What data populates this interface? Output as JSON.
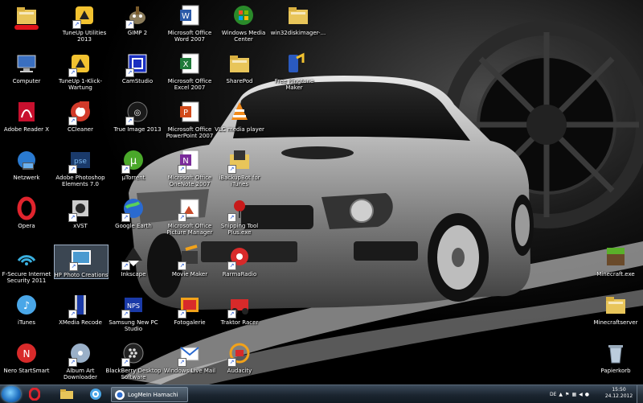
{
  "desktop": {
    "icons": [
      {
        "id": "folder-user",
        "label": "",
        "icon": "folder-icon"
      },
      {
        "id": "tuneup",
        "label": "TuneUp Utilities 2013",
        "icon": "tuneup-icon"
      },
      {
        "id": "gimp",
        "label": "GIMP 2",
        "icon": "gimp-icon"
      },
      {
        "id": "word",
        "label": "Microsoft Office Word 2007",
        "icon": "word-icon"
      },
      {
        "id": "wmc",
        "label": "Windows Media Center",
        "icon": "windows-media-center-icon"
      },
      {
        "id": "win32",
        "label": "win32diskimager-...",
        "icon": "folder-icon"
      },
      {
        "id": "computer",
        "label": "Computer",
        "icon": "computer-icon"
      },
      {
        "id": "tuneup1",
        "label": "TuneUp 1-Klick-Wartung",
        "icon": "tuneup-icon"
      },
      {
        "id": "camstudio",
        "label": "CamStudio",
        "icon": "camstudio-icon"
      },
      {
        "id": "excel",
        "label": "Microsoft Office Excel 2007",
        "icon": "excel-icon"
      },
      {
        "id": "sharepod",
        "label": "SharePod",
        "icon": "folder-icon"
      },
      {
        "id": "ringtone",
        "label": "Free Ringtone Maker",
        "icon": "ringtone-icon"
      },
      {
        "id": "reader",
        "label": "Adobe Reader X",
        "icon": "adobe-reader-icon"
      },
      {
        "id": "ccleaner",
        "label": "CCleaner",
        "icon": "ccleaner-icon"
      },
      {
        "id": "trueimage",
        "label": "True Image 2013",
        "icon": "true-image-icon"
      },
      {
        "id": "ppt",
        "label": "Microsoft Office PowerPoint 2007",
        "icon": "powerpoint-icon"
      },
      {
        "id": "vlc",
        "label": "VLC media player",
        "icon": "vlc-icon"
      },
      {
        "id": "netzwerk",
        "label": "Netzwerk",
        "icon": "network-icon"
      },
      {
        "id": "pse",
        "label": "Adobe Photoshop Elements 7.0",
        "icon": "photoshop-elements-icon"
      },
      {
        "id": "utorrent",
        "label": "µTorrent",
        "icon": "utorrent-icon"
      },
      {
        "id": "onenote",
        "label": "Microsoft Office OneNote 2007",
        "icon": "onenote-icon"
      },
      {
        "id": "ibackup",
        "label": "iBackupBot for iTunes",
        "icon": "ibackupbot-icon"
      },
      {
        "id": "opera",
        "label": "Opera",
        "icon": "opera-icon"
      },
      {
        "id": "xvst",
        "label": "xVST",
        "icon": "xvst-icon"
      },
      {
        "id": "gearth",
        "label": "Google Earth",
        "icon": "google-earth-icon"
      },
      {
        "id": "picmgr",
        "label": "Microsoft Office Picture Manager",
        "icon": "picture-manager-icon"
      },
      {
        "id": "snipping",
        "label": "Snipping Tool Plus.exe",
        "icon": "snipping-tool-icon"
      },
      {
        "id": "fsecure",
        "label": "F-Secure Internet Security 2011",
        "icon": "f-secure-icon"
      },
      {
        "id": "hpphoto",
        "label": "HP Photo Creations",
        "icon": "hp-photo-icon"
      },
      {
        "id": "inkscape",
        "label": "Inkscape",
        "icon": "inkscape-icon"
      },
      {
        "id": "moviemaker",
        "label": "Movie Maker",
        "icon": "movie-maker-icon"
      },
      {
        "id": "rarma",
        "label": "RarmaRadio",
        "icon": "rarmaradio-icon"
      },
      {
        "id": "minecraftexe",
        "label": "Minecraft.exe",
        "icon": "minecraft-icon"
      },
      {
        "id": "itunes",
        "label": "iTunes",
        "icon": "itunes-icon"
      },
      {
        "id": "xmedia",
        "label": "XMedia Recode",
        "icon": "xmedia-recode-icon"
      },
      {
        "id": "samsung",
        "label": "Samsung New PC Studio",
        "icon": "nps-icon"
      },
      {
        "id": "fotogalerie",
        "label": "Fotogalerie",
        "icon": "photo-gallery-icon"
      },
      {
        "id": "traktor",
        "label": "Traktor Racer",
        "icon": "traktor-racer-icon"
      },
      {
        "id": "minecraftserver",
        "label": "Minecraftserver",
        "icon": "folder-icon"
      },
      {
        "id": "nero",
        "label": "Nero StartSmart",
        "icon": "nero-icon"
      },
      {
        "id": "albumart",
        "label": "Album Art Downloader",
        "icon": "album-art-icon"
      },
      {
        "id": "blackberry",
        "label": "BlackBerry Desktop Software",
        "icon": "blackberry-icon"
      },
      {
        "id": "wlmail",
        "label": "Windows Live Mail",
        "icon": "windows-live-mail-icon"
      },
      {
        "id": "audacity",
        "label": "Audacity",
        "icon": "audacity-icon"
      },
      {
        "id": "papierkorb",
        "label": "Papierkorb",
        "icon": "recycle-bin-icon"
      }
    ]
  },
  "taskbar": {
    "pinned": [
      {
        "name": "opera-taskbar-icon"
      },
      {
        "name": "explorer-taskbar-icon"
      },
      {
        "name": "itunes-taskbar-icon"
      }
    ],
    "hamachi_label": "LogMeIn Hamachi",
    "language": "DE",
    "time": "15:50",
    "date": "24.12.2012"
  },
  "colors": {
    "taskbar": "#1b2530",
    "selection": "#aac8eb"
  }
}
